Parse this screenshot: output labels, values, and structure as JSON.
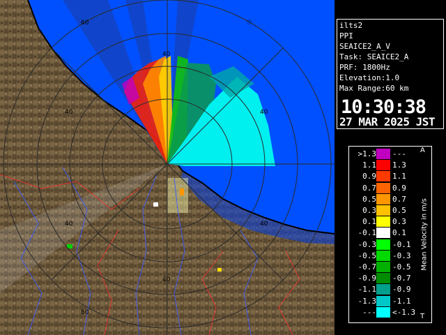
{
  "info": {
    "lines": [
      "ilts2",
      "PPI",
      "SEAICE2_A_V",
      "Task: SEAICE2_A",
      "PRF: 1800Hz",
      "Elevation:1.0",
      "Max Range:60 km"
    ],
    "time": "10:30:38",
    "date": "27 MAR 2025 JST"
  },
  "legend": {
    "title": "Mean Velocity in m/s",
    "top_mark": "A",
    "bottom_mark": "T",
    "rows": [
      {
        "lo": ">1.3",
        "hi": "---",
        "color": "#c000c0"
      },
      {
        "lo": "1.1",
        "hi": "1.3",
        "color": "#ff0000"
      },
      {
        "lo": "0.9",
        "hi": "1.1",
        "color": "#ff3a00"
      },
      {
        "lo": "0.7",
        "hi": "0.9",
        "color": "#ff6400"
      },
      {
        "lo": "0.5",
        "hi": "0.7",
        "color": "#ff9600"
      },
      {
        "lo": "0.3",
        "hi": "0.5",
        "color": "#ffc000"
      },
      {
        "lo": "0.1",
        "hi": "0.3",
        "color": "#ffff00"
      },
      {
        "lo": "-0.1",
        "hi": "0.1",
        "color": "#ffffff"
      },
      {
        "lo": "-0.3",
        "hi": "-0.1",
        "color": "#00ff00"
      },
      {
        "lo": "-0.5",
        "hi": "-0.3",
        "color": "#00d800"
      },
      {
        "lo": "-0.7",
        "hi": "-0.5",
        "color": "#00b000"
      },
      {
        "lo": "-0.9",
        "hi": "-0.7",
        "color": "#008c00"
      },
      {
        "lo": "-1.1",
        "hi": "-0.9",
        "color": "#00a08c"
      },
      {
        "lo": "-1.3",
        "hi": "-1.1",
        "color": "#00c8c8"
      },
      {
        "lo": "---",
        "hi": "<-1.3",
        "color": "#00ffff"
      }
    ]
  },
  "range_rings": {
    "labels": [
      "40",
      "60"
    ]
  },
  "colors": {
    "sea": "#0050ff",
    "land": "#6e5a3c",
    "coast": "#000000",
    "rings": "#2a2a2a",
    "rivers": "#3c5aff",
    "boundaries": "#ff3030"
  }
}
